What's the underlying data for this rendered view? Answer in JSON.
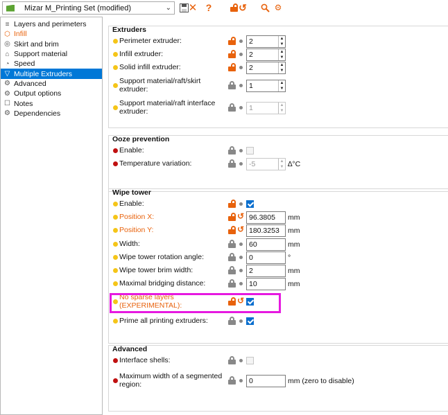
{
  "toolbar": {
    "preset_label": "Mizar M_Printing Set (modified)",
    "icons": [
      "save-icon",
      "delete-icon",
      "help-icon",
      "lock-icon",
      "undo-icon",
      "search-icon",
      "compare-icon"
    ],
    "glyphs": {
      "save": "💾",
      "delete": "✕",
      "help": "?",
      "lock": "🔓",
      "undo": "↺",
      "search": "🔍",
      "compare": "⚙"
    }
  },
  "sidebar": {
    "items": [
      {
        "label": "Layers and perimeters",
        "icon": "layers-icon"
      },
      {
        "label": "Infill",
        "icon": "infill-icon"
      },
      {
        "label": "Skirt and brim",
        "icon": "skirt-icon"
      },
      {
        "label": "Support material",
        "icon": "support-icon"
      },
      {
        "label": "Speed",
        "icon": "speed-icon"
      },
      {
        "label": "Multiple Extruders",
        "icon": "funnel-icon"
      },
      {
        "label": "Advanced",
        "icon": "advanced-icon"
      },
      {
        "label": "Output options",
        "icon": "output-icon"
      },
      {
        "label": "Notes",
        "icon": "notes-icon"
      },
      {
        "label": "Dependencies",
        "icon": "dependencies-icon"
      }
    ]
  },
  "groups": {
    "extruders": {
      "title": "Extruders",
      "perimeter_label": "Perimeter extruder:",
      "perimeter_value": "2",
      "infill_label": "Infill extruder:",
      "infill_value": "2",
      "solid_label": "Solid infill extruder:",
      "solid_value": "2",
      "support_label": "Support material/raft/skirt extruder:",
      "support_value": "1",
      "interface_label": "Support material/raft interface extruder:",
      "interface_value": "1"
    },
    "ooze": {
      "title": "Ooze prevention",
      "enable_label": "Enable:",
      "temp_label": "Temperature variation:",
      "temp_value": "-5",
      "temp_unit": "∆°C"
    },
    "wipe": {
      "title": "Wipe tower",
      "enable_label": "Enable:",
      "posx_label": "Position X:",
      "posx_value": "96.3805",
      "posx_unit": "mm",
      "posy_label": "Position Y:",
      "posy_value": "180.3253",
      "posy_unit": "mm",
      "width_label": "Width:",
      "width_value": "60",
      "width_unit": "mm",
      "rot_label": "Wipe tower rotation angle:",
      "rot_value": "0",
      "rot_unit": "°",
      "brim_label": "Wipe tower brim width:",
      "brim_value": "2",
      "brim_unit": "mm",
      "bridge_label": "Maximal bridging distance:",
      "bridge_value": "10",
      "bridge_unit": "mm",
      "sparse_label": "No sparse layers (EXPERIMENTAL):",
      "prime_label": "Prime all printing extruders:"
    },
    "advanced": {
      "title": "Advanced",
      "shells_label": "Interface shells:",
      "maxwidth_label": "Maximum width of a segmented region:",
      "maxwidth_value": "0",
      "maxwidth_unit": "mm (zero to disable)"
    }
  },
  "colors": {
    "modified_orange": "#e8620c",
    "selection_blue": "#0078d7",
    "highlight_magenta": "#e619e0",
    "checkbox_blue": "#0b6fce"
  }
}
